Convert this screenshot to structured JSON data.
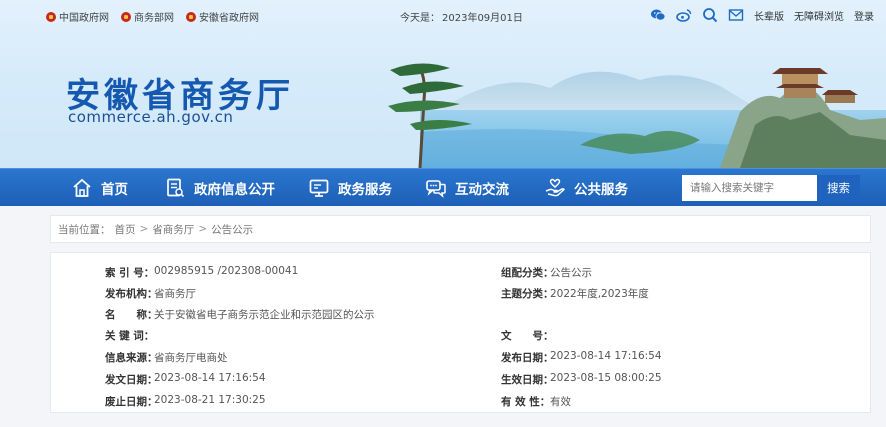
{
  "topbar": {
    "links": [
      "中国政府网",
      "商务部网",
      "安徽省政府网"
    ],
    "date_prefix": "今天是：",
    "date": "2023年09月01日",
    "right_links": [
      "长辈版",
      "无障碍浏览",
      "登录"
    ],
    "icons": [
      "wechat-icon",
      "weibo-icon",
      "search-icon",
      "mail-icon"
    ]
  },
  "header": {
    "title": "安徽省商务厅",
    "domain": "commerce.ah.gov.cn"
  },
  "nav": {
    "items": [
      {
        "label": "首页",
        "icon": "home-icon"
      },
      {
        "label": "政府信息公开",
        "icon": "document-icon"
      },
      {
        "label": "政务服务",
        "icon": "monitor-icon"
      },
      {
        "label": "互动交流",
        "icon": "chat-icon"
      },
      {
        "label": "公共服务",
        "icon": "hand-heart-icon"
      }
    ],
    "search_placeholder": "请输入搜索关键字",
    "search_button": "搜索"
  },
  "breadcrumb": {
    "prefix": "当前位置：",
    "items": [
      "首页",
      "省商务厅",
      "公告公示"
    ],
    "separator": ">"
  },
  "info": {
    "rows": [
      {
        "left_label": "索 引 号：",
        "left_value": "002985915 /202308-00041",
        "right_label": "组配分类：",
        "right_value": "公告公示"
      },
      {
        "left_label": "发布机构：",
        "left_value": "省商务厅",
        "right_label": "主题分类：",
        "right_value": "2022年度,2023年度"
      },
      {
        "left_label": "名　　称：",
        "left_value": "关于安徽省电子商务示范企业和示范园区的公示"
      },
      {
        "left_label": "关 键 词：",
        "left_value": "",
        "right_label": "文　　号：",
        "right_value": ""
      },
      {
        "left_label": "信息来源：",
        "left_value": "省商务厅电商处",
        "right_label": "发布日期：",
        "right_value": "2023-08-14 17:16:54"
      },
      {
        "left_label": "发文日期：",
        "left_value": "2023-08-14 17:16:54",
        "right_label": "生效日期：",
        "right_value": "2023-08-15 08:00:25"
      },
      {
        "left_label": "废止日期：",
        "left_value": "2023-08-21 17:30:25",
        "right_label": "有 效 性：",
        "right_value": "有效"
      }
    ]
  },
  "colors": {
    "brand_blue": "#1558b0",
    "nav_blue": "#1d5fb6",
    "emblem_red": "#c8281e"
  }
}
